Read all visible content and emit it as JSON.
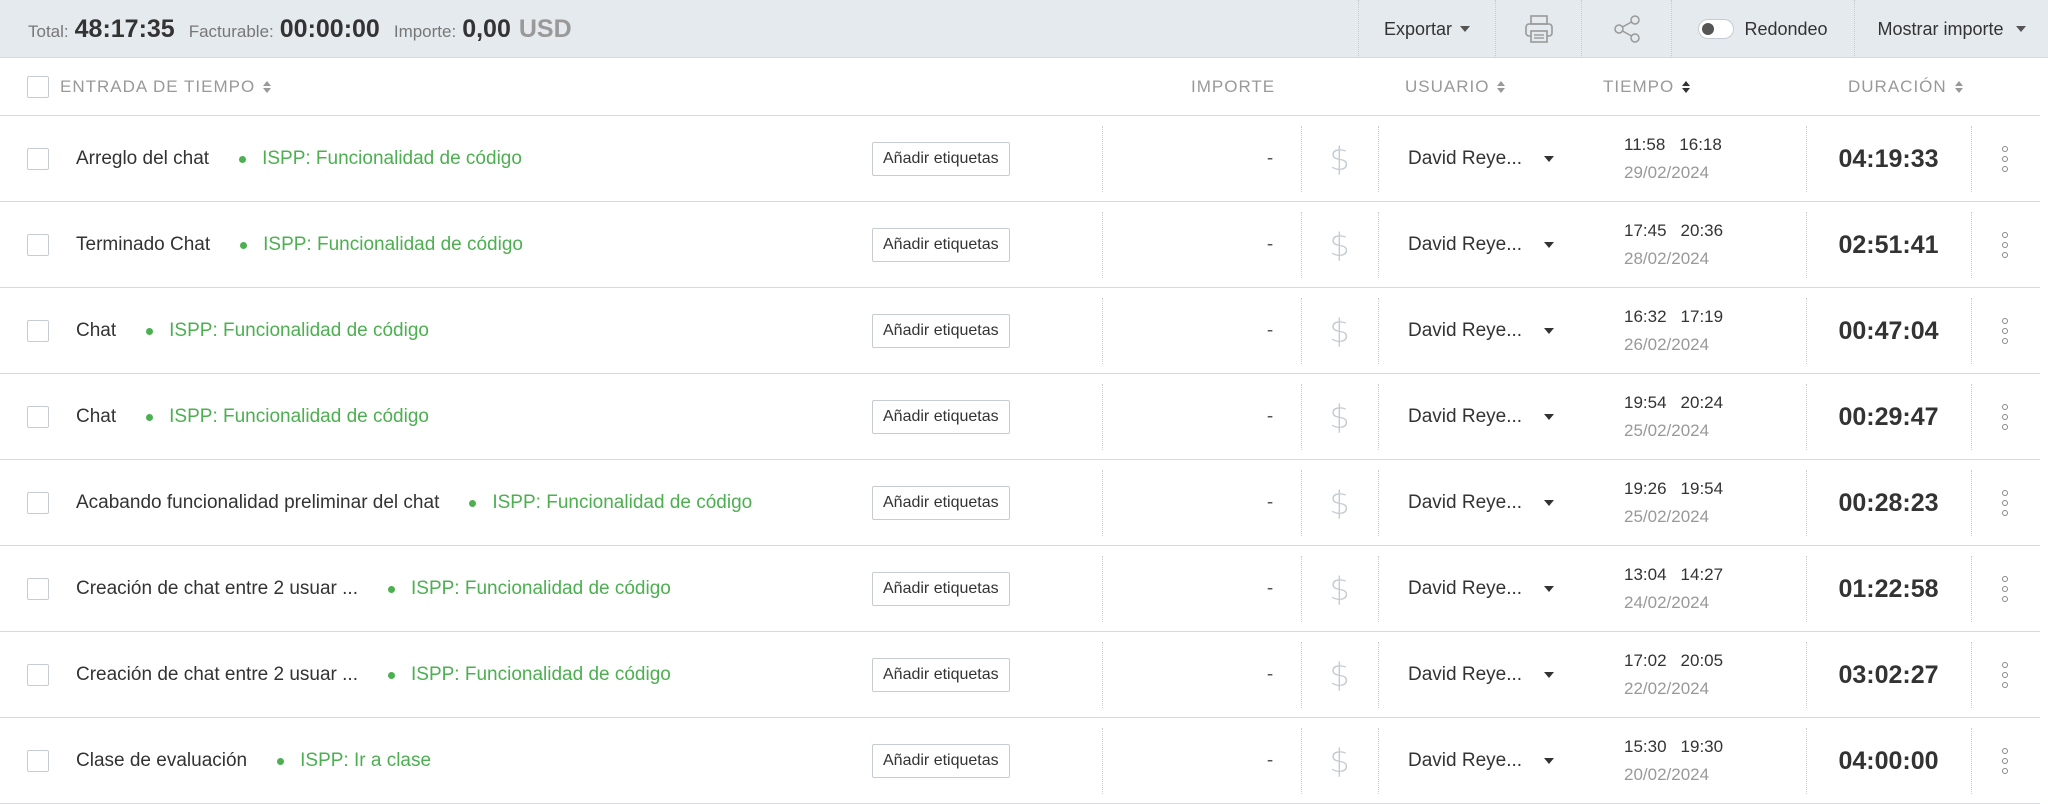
{
  "summary": {
    "total_label": "Total:",
    "total_value": "48:17:35",
    "billable_label": "Facturable:",
    "billable_value": "00:00:00",
    "amount_label": "Importe:",
    "amount_value": "0,00",
    "amount_currency": "USD"
  },
  "toolbar": {
    "export_label": "Exportar",
    "rounding_label": "Redondeo",
    "show_amount_label": "Mostrar importe"
  },
  "columns": {
    "entry": "ENTRADA DE TIEMPO",
    "amount": "IMPORTE",
    "user": "USUARIO",
    "time": "TIEMPO",
    "duration": "DURACIÓN"
  },
  "tag_button_label": "Añadir etiquetas",
  "dollar_symbol": "$",
  "colors": {
    "project": "#4caf50",
    "topbar": "#e4eaee"
  },
  "entries": [
    {
      "description": "Arreglo del chat",
      "project": "ISPP: Funcionalidad de código",
      "amount": "-",
      "user": "David Reye...",
      "start": "11:58",
      "end": "16:18",
      "date": "29/02/2024",
      "duration": "04:19:33"
    },
    {
      "description": "Terminado Chat",
      "project": "ISPP: Funcionalidad de código",
      "amount": "-",
      "user": "David Reye...",
      "start": "17:45",
      "end": "20:36",
      "date": "28/02/2024",
      "duration": "02:51:41"
    },
    {
      "description": "Chat",
      "project": "ISPP: Funcionalidad de código",
      "amount": "-",
      "user": "David Reye...",
      "start": "16:32",
      "end": "17:19",
      "date": "26/02/2024",
      "duration": "00:47:04"
    },
    {
      "description": "Chat",
      "project": "ISPP: Funcionalidad de código",
      "amount": "-",
      "user": "David Reye...",
      "start": "19:54",
      "end": "20:24",
      "date": "25/02/2024",
      "duration": "00:29:47"
    },
    {
      "description": "Acabando funcionalidad preliminar del chat",
      "project": "ISPP: Funcionalidad de código",
      "amount": "-",
      "user": "David Reye...",
      "start": "19:26",
      "end": "19:54",
      "date": "25/02/2024",
      "duration": "00:28:23"
    },
    {
      "description": "Creación de  chat  entre 2 usuar ...",
      "project": "ISPP: Funcionalidad de código",
      "amount": "-",
      "user": "David Reye...",
      "start": "13:04",
      "end": "14:27",
      "date": "24/02/2024",
      "duration": "01:22:58"
    },
    {
      "description": "Creación de  chat  entre 2 usuar ...",
      "project": "ISPP: Funcionalidad de código",
      "amount": "-",
      "user": "David Reye...",
      "start": "17:02",
      "end": "20:05",
      "date": "22/02/2024",
      "duration": "03:02:27"
    },
    {
      "description": "Clase de evaluación",
      "project": "ISPP: Ir a clase",
      "amount": "-",
      "user": "David Reye...",
      "start": "15:30",
      "end": "19:30",
      "date": "20/02/2024",
      "duration": "04:00:00"
    }
  ]
}
